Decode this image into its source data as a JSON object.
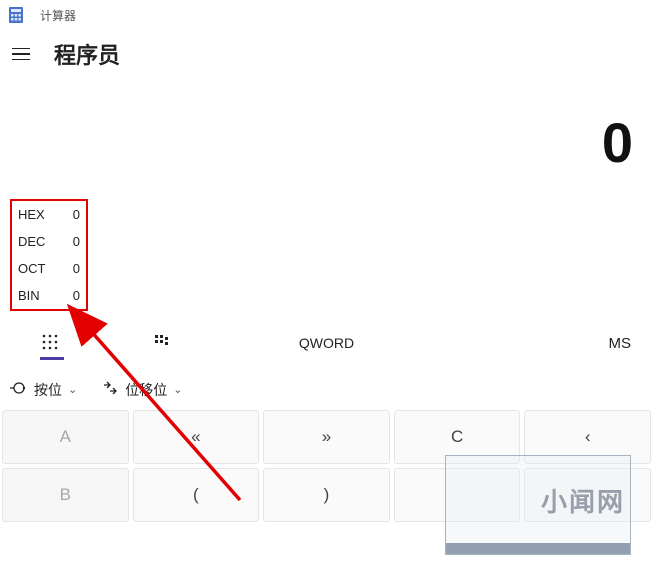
{
  "title": "计算器",
  "mode": "程序员",
  "display_value": "0",
  "bases": [
    {
      "label": "HEX",
      "value": "0"
    },
    {
      "label": "DEC",
      "value": "0"
    },
    {
      "label": "OCT",
      "value": "0"
    },
    {
      "label": "BIN",
      "value": "0"
    }
  ],
  "toolbar": {
    "word_size": "QWORD",
    "memory_store": "MS"
  },
  "bitops": {
    "bitwise_label": "按位",
    "bitshift_label": "位移位"
  },
  "keys_row1": [
    {
      "name": "key-a",
      "label": "A",
      "enabled": false
    },
    {
      "name": "key-shift-left",
      "label": "«",
      "enabled": true
    },
    {
      "name": "key-shift-right",
      "label": "»",
      "enabled": true
    },
    {
      "name": "key-clear",
      "label": "C",
      "enabled": true
    },
    {
      "name": "key-backspace",
      "label": "‹",
      "enabled": true
    }
  ],
  "keys_row2": [
    {
      "name": "key-b",
      "label": "B",
      "enabled": false
    },
    {
      "name": "key-open-paren",
      "label": "(",
      "enabled": true
    },
    {
      "name": "key-close-paren",
      "label": ")",
      "enabled": true
    },
    {
      "name": "key-percent",
      "label": "",
      "enabled": true
    },
    {
      "name": "key-divide",
      "label": "",
      "enabled": true
    }
  ],
  "watermark": "小闻网",
  "annotation_color": "#e30000"
}
